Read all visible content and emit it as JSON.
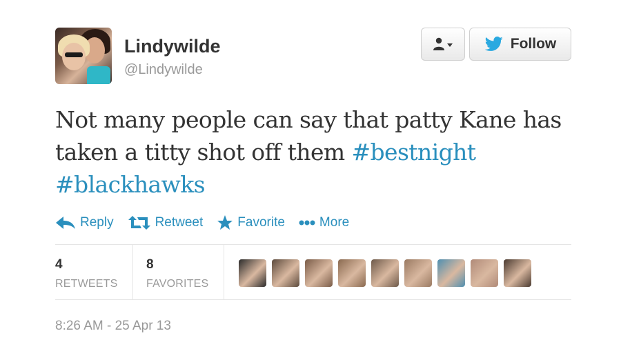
{
  "user": {
    "display_name": "Lindywilde",
    "handle": "@Lindywilde"
  },
  "buttons": {
    "user_menu_icon": "person-dropdown-icon",
    "follow_label": "Follow"
  },
  "tweet": {
    "text_plain": "Not many people can say that patty Kane has taken a titty shot off them ",
    "hashtags": [
      "#bestnight",
      "#blackhawks"
    ]
  },
  "actions": {
    "reply": "Reply",
    "retweet": "Retweet",
    "favorite": "Favorite",
    "more": "More"
  },
  "stats": {
    "retweets_count": "4",
    "retweets_label": "RETWEETS",
    "favorites_count": "8",
    "favorites_label": "FAVORITES"
  },
  "favoriters": [
    {
      "color": "#2b2b2b"
    },
    {
      "color": "#5c4a3c"
    },
    {
      "color": "#7a5c48"
    },
    {
      "color": "#8a6a50"
    },
    {
      "color": "#6e5a4a"
    },
    {
      "color": "#9a7a62"
    },
    {
      "color": "#4f8fb0"
    },
    {
      "color": "#b08a78"
    },
    {
      "color": "#4a3a30"
    }
  ],
  "timestamp": "8:26 AM - 25 Apr 13",
  "colors": {
    "link": "#2a8fbd",
    "twitter_blue": "#2aa9e0",
    "muted": "#999999",
    "text": "#333333"
  }
}
